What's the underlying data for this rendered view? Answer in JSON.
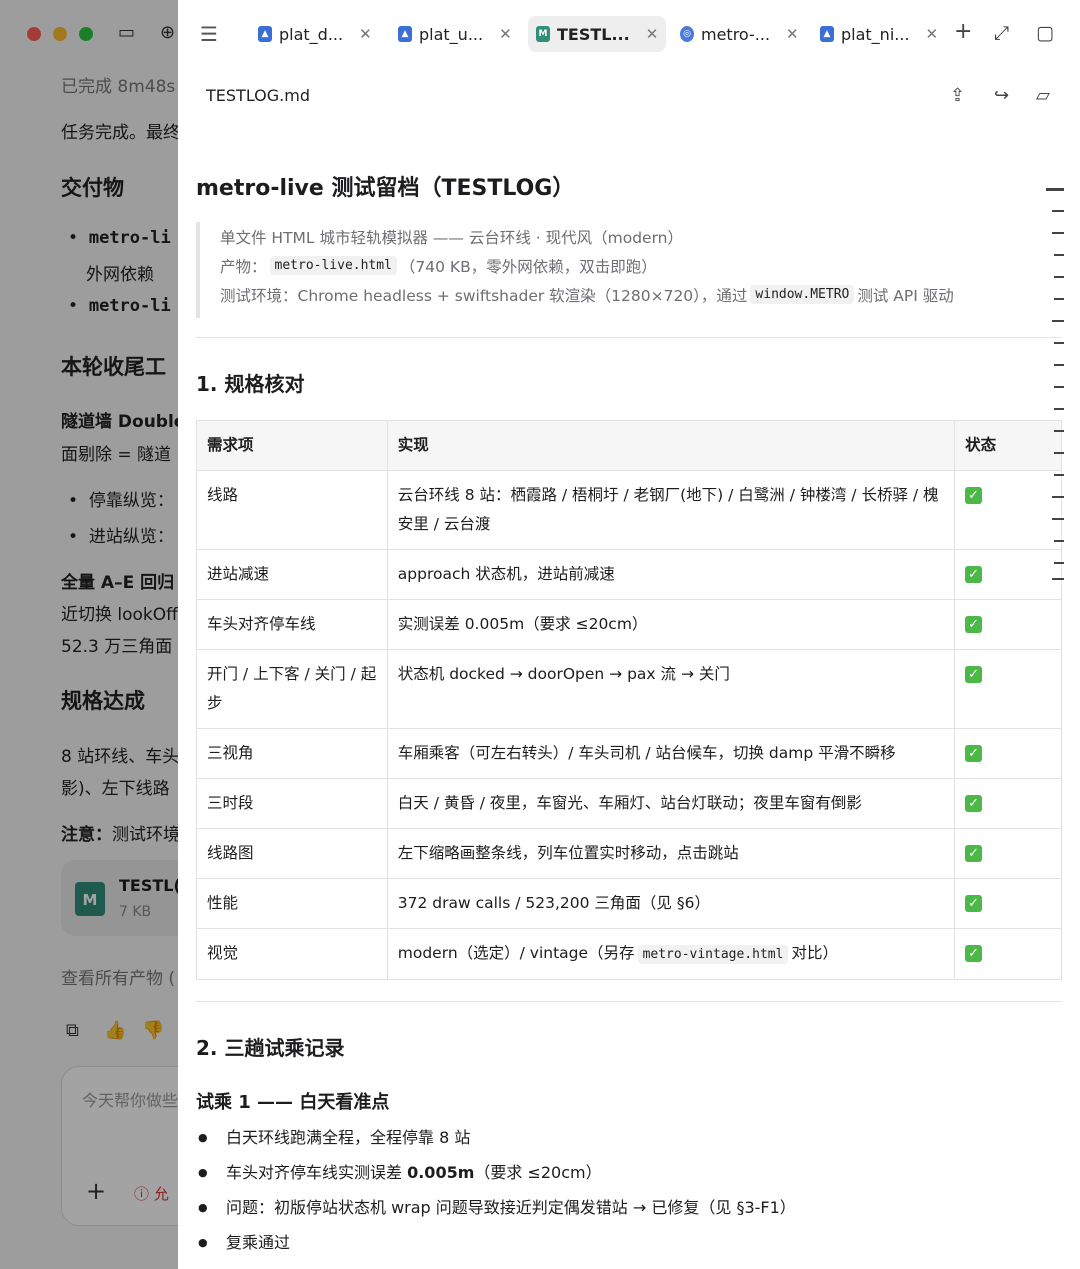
{
  "sidebar_chat": {
    "status": "已完成 8m48s",
    "line1": "任务完成。最终",
    "deliverables_heading": "交付物",
    "deliverable1_code": "metro-li",
    "deliverable1_sub": "外网依赖",
    "deliverable2_code": "metro-li",
    "wrapup_heading": "本轮收尾工",
    "tunnel_line1": "隧道墙 Double",
    "tunnel_line2": "面剔除 = 隧道",
    "bullet1": "停靠纵览：",
    "bullet2": "进站纵览：",
    "ae_line1": "全量 A–E 回归",
    "ae_line2": "近切换 lookOff",
    "ae_line3": "52.3 万三角面",
    "spec_heading": "规格达成",
    "spec_line1": "8 站环线、车头",
    "spec_line2": "影)、左下线路",
    "note_label": "注意：",
    "note_text": "测试环境",
    "card_title": "TESTL(",
    "card_size": "7 KB",
    "card_icon": "M",
    "view_all": "查看所有产物 (",
    "input_placeholder": "今天帮你做些",
    "input_warn": "允"
  },
  "tabs": [
    {
      "label": "plat_d...",
      "icon": "image",
      "active": false
    },
    {
      "label": "plat_u...",
      "icon": "image",
      "active": false
    },
    {
      "label": "TESTL...",
      "icon": "markdown",
      "active": true
    },
    {
      "label": "metro-...",
      "icon": "web",
      "active": false
    },
    {
      "label": "plat_ni...",
      "icon": "image",
      "active": false
    }
  ],
  "file": {
    "name": "TESTLOG.md"
  },
  "doc": {
    "title": "metro-live 测试留档（TESTLOG）",
    "bq1": "单文件 HTML 城市轻轨模拟器 —— 云台环线 · 现代风（modern）",
    "bq2_prefix": "产物：",
    "bq2_code": "metro-live.html",
    "bq2_suffix": "（740 KB，零外网依赖，双击即跑）",
    "bq3_prefix": "测试环境：Chrome headless + swiftshader 软渲染（1280×720），通过",
    "bq3_code": "window.METRO",
    "bq3_suffix": "测试 API 驱动",
    "section1": "1. 规格核对",
    "table_headers": [
      "需求项",
      "实现",
      "状态"
    ],
    "rows": [
      {
        "item": "线路",
        "impl": "云台环线 8 站：栖霞路 / 梧桐圩 / 老钢厂(地下) / 白鹭洲 / 钟楼湾 / 长桥驿 / 槐安里 / 云台渡"
      },
      {
        "item": "进站减速",
        "impl": "approach 状态机，进站前减速"
      },
      {
        "item": "车头对齐停车线",
        "impl": "实测误差 0.005m（要求 ≤20cm）"
      },
      {
        "item": "开门 / 上下客 / 关门 / 起步",
        "impl": "状态机 docked → doorOpen → pax 流 → 关门"
      },
      {
        "item": "三视角",
        "impl": "车厢乘客（可左右转头）/ 车头司机 / 站台候车，切换 damp 平滑不瞬移"
      },
      {
        "item": "三时段",
        "impl": "白天 / 黄昏 / 夜里，车窗光、车厢灯、站台灯联动；夜里车窗有倒影"
      },
      {
        "item": "线路图",
        "impl": "左下缩略画整条线，列车位置实时移动，点击跳站"
      },
      {
        "item": "性能",
        "impl": "372 draw calls / 523,200 三角面（见 §6）"
      },
      {
        "item": "视觉",
        "impl_prefix": "modern（选定）/ vintage（另存",
        "impl_code": "metro-vintage.html",
        "impl_suffix": "对比）"
      }
    ],
    "status_symbol": "✓",
    "section2": "2. 三趟试乘记录",
    "trial1_heading": "试乘 1 —— 白天看准点",
    "trial1_items": [
      {
        "text": "白天环线跑满全程，全程停靠 8 站"
      },
      {
        "prefix": "车头对齐停车线实测误差 ",
        "bold": "0.005m",
        "suffix": "（要求 ≤20cm）"
      },
      {
        "text": "问题：初版停站状态机 wrap 问题导致接近判定偶发错站 → 已修复（见 §3-F1）"
      },
      {
        "text": "复乘通过"
      }
    ]
  },
  "colors": {
    "accent_check": "#4cb848",
    "markdown_icon": "#2f8f7a",
    "image_icon": "#3a6fd8"
  }
}
